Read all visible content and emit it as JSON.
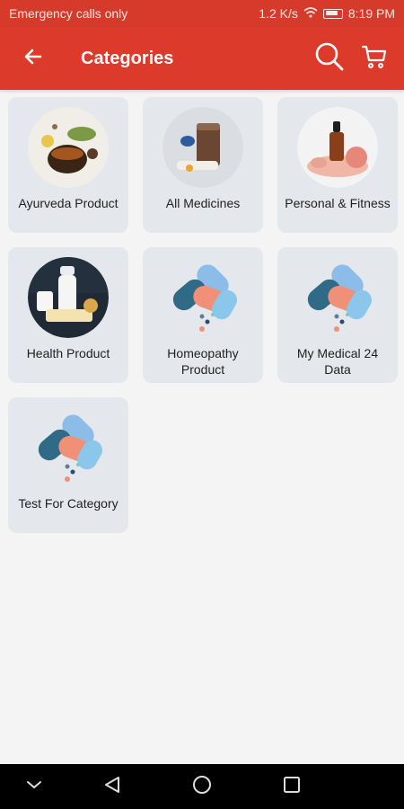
{
  "status": {
    "carrier": "Emergency calls only",
    "speed": "1.2 K/s",
    "time": "8:19 PM"
  },
  "app_bar": {
    "title": "Categories",
    "back_icon": "arrow-left-icon",
    "search_icon": "search-icon",
    "cart_icon": "cart-icon"
  },
  "categories": [
    {
      "label": "Ayurveda Product",
      "image": "ayurveda-tea-photo"
    },
    {
      "label": "All Medicines",
      "image": "medicine-smoothie-photo"
    },
    {
      "label": "Personal & Fitness",
      "image": "oil-dropper-rose-photo"
    },
    {
      "label": "Health Product",
      "image": "milk-cheese-photo"
    },
    {
      "label": "Homeopathy Product",
      "image": "pills-icon"
    },
    {
      "label": "My Medical 24 Data",
      "image": "pills-icon"
    },
    {
      "label": "Test For Category",
      "image": "pills-icon"
    }
  ],
  "colors": {
    "brand": "#dc3b2b",
    "card_bg": "#e4e7eb",
    "background": "#f4f4f4"
  },
  "nav": [
    "back-triangle-icon",
    "home-circle-icon",
    "recents-square-icon",
    "chevron-down-icon"
  ]
}
